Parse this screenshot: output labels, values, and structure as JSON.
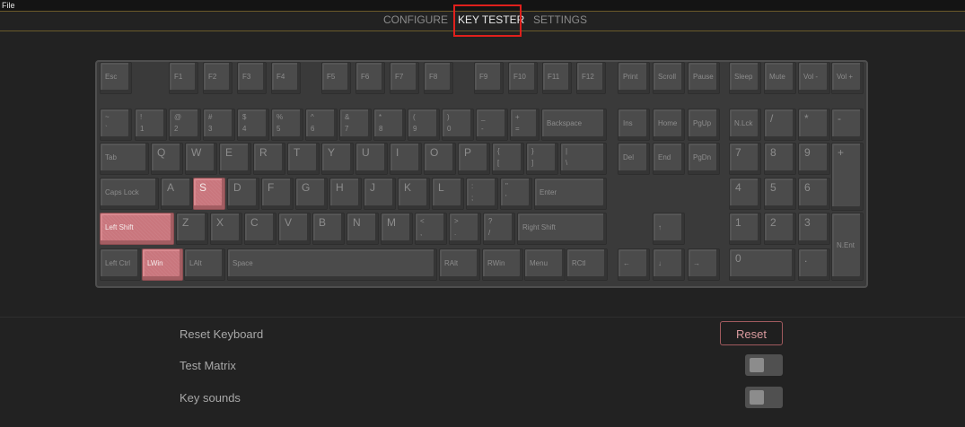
{
  "menu": {
    "file": "File"
  },
  "tabs": [
    {
      "label": "CONFIGURE",
      "active": false
    },
    {
      "label": "KEY TESTER",
      "active": true
    },
    {
      "label": "SETTINGS",
      "active": false
    }
  ],
  "keys": {
    "esc": {
      "l1": "Esc"
    },
    "f1": {
      "l1": "F1"
    },
    "f2": {
      "l1": "F2"
    },
    "f3": {
      "l1": "F3"
    },
    "f4": {
      "l1": "F4"
    },
    "f5": {
      "l1": "F5"
    },
    "f6": {
      "l1": "F6"
    },
    "f7": {
      "l1": "F7"
    },
    "f8": {
      "l1": "F8"
    },
    "f9": {
      "l1": "F9"
    },
    "f10": {
      "l1": "F10"
    },
    "f11": {
      "l1": "F11"
    },
    "f12": {
      "l1": "F12"
    },
    "print": {
      "l1": "Print"
    },
    "scroll": {
      "l1": "Scroll"
    },
    "pause": {
      "l1": "Pause"
    },
    "sleep": {
      "l1": "Sleep"
    },
    "mute": {
      "l1": "Mute"
    },
    "voldown": {
      "l1": "Vol -"
    },
    "volup": {
      "l1": "Vol +"
    },
    "grave": {
      "l1": "~",
      "l2": "`"
    },
    "n1": {
      "l1": "!",
      "l2": "1"
    },
    "n2": {
      "l1": "@",
      "l2": "2"
    },
    "n3": {
      "l1": "#",
      "l2": "3"
    },
    "n4": {
      "l1": "$",
      "l2": "4"
    },
    "n5": {
      "l1": "%",
      "l2": "5"
    },
    "n6": {
      "l1": "^",
      "l2": "6"
    },
    "n7": {
      "l1": "&",
      "l2": "7"
    },
    "n8": {
      "l1": "*",
      "l2": "8"
    },
    "n9": {
      "l1": "(",
      "l2": "9"
    },
    "n0": {
      "l1": ")",
      "l2": "0"
    },
    "minus": {
      "l1": "_",
      "l2": "-"
    },
    "equal": {
      "l1": "+",
      "l2": "="
    },
    "backspace": {
      "l1": "Backspace"
    },
    "ins": {
      "l1": "Ins"
    },
    "home": {
      "l1": "Home"
    },
    "pgup": {
      "l1": "PgUp"
    },
    "nlck": {
      "l1": "N.Lck"
    },
    "kpslash": {
      "l1": "/"
    },
    "kpstar": {
      "l1": "*"
    },
    "kpminus": {
      "l1": "-"
    },
    "tab": {
      "l1": "Tab"
    },
    "q": {
      "l1": "Q"
    },
    "w": {
      "l1": "W"
    },
    "e": {
      "l1": "E"
    },
    "r": {
      "l1": "R"
    },
    "t": {
      "l1": "T"
    },
    "y": {
      "l1": "Y"
    },
    "u": {
      "l1": "U"
    },
    "i": {
      "l1": "I"
    },
    "o": {
      "l1": "O"
    },
    "p": {
      "l1": "P"
    },
    "lbracket": {
      "l1": "{",
      "l2": "["
    },
    "rbracket": {
      "l1": "}",
      "l2": "]"
    },
    "backslash": {
      "l1": "|",
      "l2": "\\"
    },
    "del": {
      "l1": "Del"
    },
    "end": {
      "l1": "End"
    },
    "pgdn": {
      "l1": "PgDn"
    },
    "kp7": {
      "l1": "7"
    },
    "kp8": {
      "l1": "8"
    },
    "kp9": {
      "l1": "9"
    },
    "kpplus": {
      "l1": "+"
    },
    "caps": {
      "l1": "Caps Lock"
    },
    "a": {
      "l1": "A"
    },
    "s": {
      "l1": "S"
    },
    "d": {
      "l1": "D"
    },
    "f": {
      "l1": "F"
    },
    "g": {
      "l1": "G"
    },
    "h": {
      "l1": "H"
    },
    "j": {
      "l1": "J"
    },
    "k": {
      "l1": "K"
    },
    "l": {
      "l1": "L"
    },
    "semicolon": {
      "l1": ":",
      "l2": ";"
    },
    "quote": {
      "l1": "\"",
      "l2": "'"
    },
    "enter": {
      "l1": "Enter"
    },
    "kp4": {
      "l1": "4"
    },
    "kp5": {
      "l1": "5"
    },
    "kp6": {
      "l1": "6"
    },
    "lshift": {
      "l1": "Left Shift"
    },
    "z": {
      "l1": "Z"
    },
    "x": {
      "l1": "X"
    },
    "c": {
      "l1": "C"
    },
    "v": {
      "l1": "V"
    },
    "b": {
      "l1": "B"
    },
    "n": {
      "l1": "N"
    },
    "m": {
      "l1": "M"
    },
    "comma": {
      "l1": "<",
      "l2": ","
    },
    "period": {
      "l1": ">",
      "l2": "."
    },
    "slash": {
      "l1": "?",
      "l2": "/"
    },
    "rshift": {
      "l1": "Right Shift"
    },
    "up": {
      "l1": "↑"
    },
    "kp1": {
      "l1": "1"
    },
    "kp2": {
      "l1": "2"
    },
    "kp3": {
      "l1": "3"
    },
    "kpenter": {
      "l1": "N.Ent"
    },
    "lctrl": {
      "l1": "Left Ctrl"
    },
    "lwin": {
      "l1": "LWin"
    },
    "lalt": {
      "l1": "LAlt"
    },
    "space": {
      "l1": "Space"
    },
    "ralt": {
      "l1": "RAlt"
    },
    "rwin": {
      "l1": "RWin"
    },
    "menu": {
      "l1": "Menu"
    },
    "rctl": {
      "l1": "RCtl"
    },
    "left": {
      "l1": "←"
    },
    "down": {
      "l1": "↓"
    },
    "right": {
      "l1": "→"
    },
    "kp0": {
      "l1": "0"
    },
    "kpdot": {
      "l1": "."
    }
  },
  "pressed_keys": [
    "s",
    "lshift",
    "lwin"
  ],
  "settings": {
    "reset_label": "Reset Keyboard",
    "reset_button": "Reset",
    "test_matrix_label": "Test Matrix",
    "test_matrix_on": false,
    "key_sounds_label": "Key sounds",
    "key_sounds_on": false
  },
  "colors": {
    "background": "#222222",
    "key": "#4b4b4b",
    "pressed_key": "#c9767d",
    "accent_border": "#6a5a2a",
    "highlight_box": "#e0201c"
  }
}
